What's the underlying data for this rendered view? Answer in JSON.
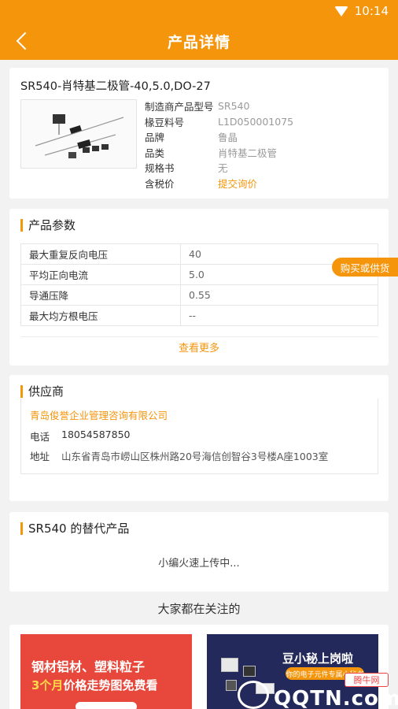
{
  "status_bar": {
    "time": "10:14"
  },
  "nav": {
    "title": "产品详情"
  },
  "product": {
    "title": "SR540-肖特基二极管-40,5.0,DO-27",
    "fields": [
      {
        "key": "制造商产品型号",
        "value": "SR540"
      },
      {
        "key": "椽豆料号",
        "value": "L1D050001075"
      },
      {
        "key": "品牌",
        "value": "鲁晶"
      },
      {
        "key": "品类",
        "value": "肖特基二极管"
      },
      {
        "key": "规格书",
        "value": "无"
      },
      {
        "key": "含税价",
        "value": "提交询价"
      }
    ]
  },
  "params": {
    "title": "产品参数",
    "rows": [
      {
        "key": "最大重复反向电压",
        "value": "40"
      },
      {
        "key": "平均正向电流",
        "value": "5.0"
      },
      {
        "key": "导通压降",
        "value": "0.55"
      },
      {
        "key": "最大均方根电压",
        "value": "--"
      }
    ],
    "more": "查看更多"
  },
  "float_button": "购买或供货",
  "supplier": {
    "title": "供应商",
    "name": "青岛俊誉企业管理咨询有限公司",
    "phone_label": "电话",
    "phone": "18054587850",
    "address_label": "地址",
    "address": "山东省青岛市崂山区株州路20号海信创智谷3号楼A座1003室"
  },
  "alternatives": {
    "title": "SR540 的替代产品",
    "placeholder": "小编火速上传中..."
  },
  "watching": {
    "title": "大家都在关注的"
  },
  "banners": {
    "left_line1": "钢材铝材、塑料粒子",
    "left_line2_highlight": "3个月",
    "left_line2_rest": "价格走势图免费看",
    "right_title": "豆小秘上岗啦",
    "right_pill": "你的电子元件专属小秘书"
  },
  "watermark": {
    "badge": "腾牛网",
    "text": "QQTN.com"
  },
  "colors": {
    "accent": "#f5950c",
    "banner_red": "#e7483b",
    "banner_navy": "#23295a"
  }
}
